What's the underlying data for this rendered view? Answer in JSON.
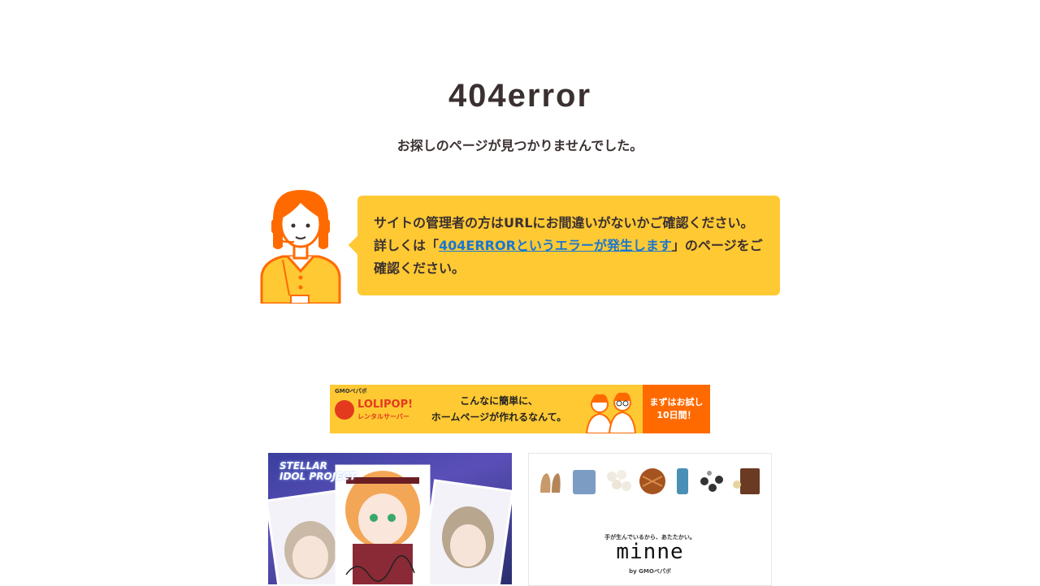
{
  "heading": {
    "title": "404error",
    "subtitle": "お探しのページが見つかりませんでした。"
  },
  "message": {
    "line1": "サイトの管理者の方はURLにお間違いがないかご確認ください。",
    "prefix": "詳しくは「",
    "link_text": "404ERRORというエラーが発生します",
    "suffix": "」のページをご確認ください。"
  },
  "banner": {
    "gmo_label": "GMOペパボ",
    "brand": "LOLIPOP!",
    "brand_sub": "レンタルサーバー",
    "copy_line1": "こんなに簡単に、",
    "copy_line2": "ホームページが作れるなんて。",
    "cta_line1": "まずはお試し",
    "cta_line2": "10日間！"
  },
  "ad1": {
    "title_line1": "STELLAR",
    "title_line2": "IDOL PROJECT"
  },
  "ad2": {
    "tagline": "手が生んでいるから、あたたかい。",
    "logo": "minne",
    "by": "by GMOペパボ"
  },
  "colors": {
    "accent": "#ffc933",
    "orange": "#ff6a00",
    "link": "#1976d2",
    "text": "#3b3030"
  }
}
